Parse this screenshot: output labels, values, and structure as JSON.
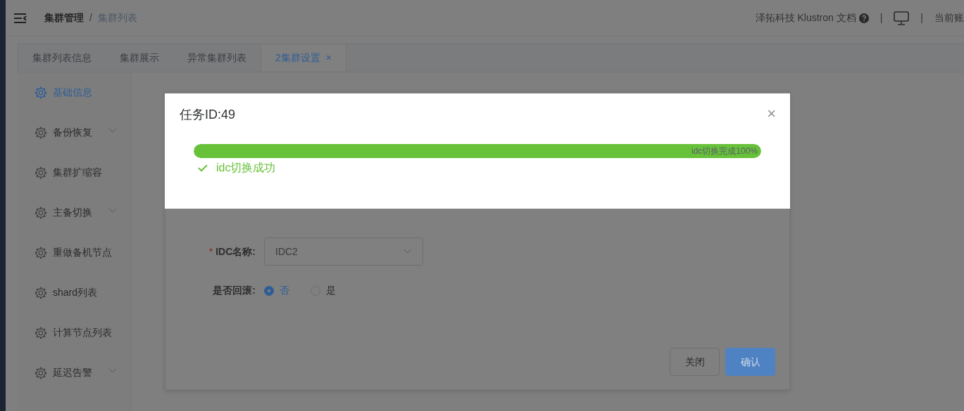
{
  "header": {
    "breadcrumb": [
      {
        "label": "集群管理",
        "current": false
      },
      {
        "label": "集群列表",
        "current": true
      }
    ],
    "breadcrumb_separator": "/",
    "docs_label": "泽拓科技 Klustron 文档",
    "separators": [
      "|",
      "|"
    ],
    "account_label": "当前账"
  },
  "tabs": [
    {
      "label": "集群列表信息",
      "selected": false
    },
    {
      "label": "集群展示",
      "selected": false
    },
    {
      "label": "异常集群列表",
      "selected": false
    },
    {
      "label": "2集群设置",
      "selected": true,
      "close": "×"
    }
  ],
  "sidebar": {
    "items": [
      {
        "label": "基础信息",
        "selected": true,
        "expandable": false
      },
      {
        "label": "备份恢复",
        "selected": false,
        "expandable": true
      },
      {
        "label": "集群扩缩容",
        "selected": false,
        "expandable": false
      },
      {
        "label": "主备切换",
        "selected": false,
        "expandable": true
      },
      {
        "label": "重做备机节点",
        "selected": false,
        "expandable": false
      },
      {
        "label": "shard列表",
        "selected": false,
        "expandable": false
      },
      {
        "label": "计算节点列表",
        "selected": false,
        "expandable": false
      },
      {
        "label": "延迟告警",
        "selected": false,
        "expandable": true
      }
    ]
  },
  "form": {
    "fields": [
      {
        "kind": "select",
        "label": "IDC名称:",
        "required_mark": "*",
        "value": "IDC2"
      },
      {
        "kind": "radio",
        "label": "是否回滚:",
        "options": [
          {
            "label": "否",
            "selected": true
          },
          {
            "label": "是",
            "selected": false
          }
        ]
      }
    ],
    "buttons": [
      {
        "label": "关闭",
        "kind": "default"
      },
      {
        "label": "确认",
        "kind": "primary"
      }
    ]
  },
  "dialog": {
    "title": "任务ID:49",
    "close": "×",
    "progress": {
      "level": 1,
      "label": "idc切换完成100%"
    },
    "status": {
      "kind": "success",
      "text": "idc切换成功"
    }
  }
}
